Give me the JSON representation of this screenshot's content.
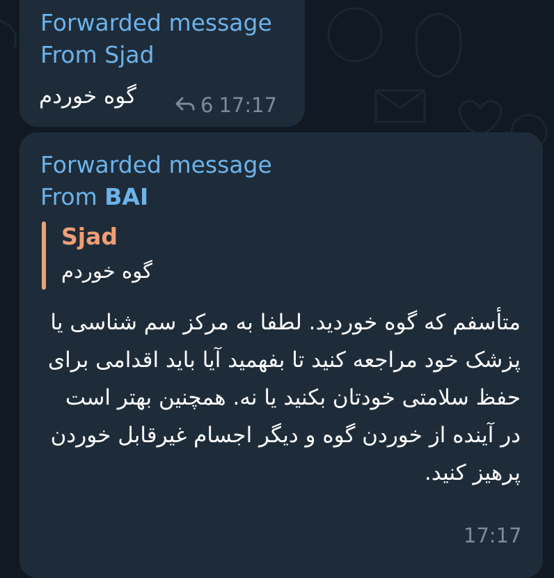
{
  "colors": {
    "background": "#111a22",
    "bubble": "#1e2c3a",
    "forward_blue": "#6cb3ea",
    "quote_accent": "#e8a27a",
    "meta_gray": "#7d8b99"
  },
  "messages": [
    {
      "forward_label": "Forwarded message",
      "from_prefix": "From ",
      "from_name": "Sjad",
      "text": "گوه خوردم",
      "reply_icon": "reply-arrow-icon",
      "forward_count": "6",
      "time": "17:17"
    },
    {
      "forward_label": "Forwarded message",
      "from_prefix": "From ",
      "from_name": "BAI",
      "quote": {
        "name": "Sjad",
        "text": "گوه خوردم"
      },
      "body": "متأسفم که گوه خوردید. لطفا به مرکز سم شناسی یا پزشک خود مراجعه کنید تا بفهمید آیا باید اقدامی برای حفظ سلامتی خودتان بکنید یا نه. همچنین بهتر است در آینده از خوردن گوه و دیگر اجسام غیرقابل خوردن پرهیز کنید.",
      "time": "17:17"
    }
  ]
}
